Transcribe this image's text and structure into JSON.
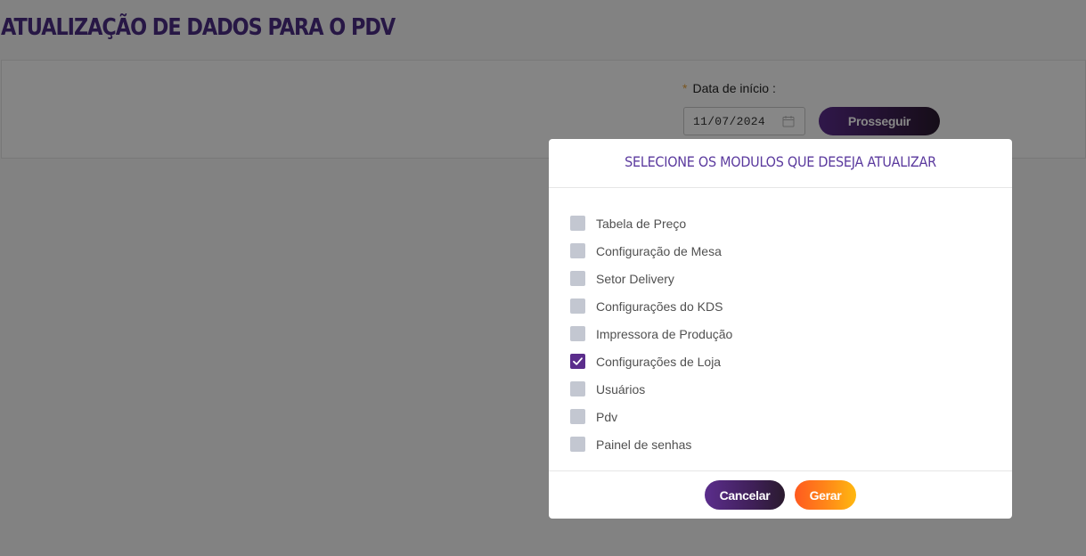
{
  "page": {
    "title": "ATUALIZAÇÃO DE DADOS PARA O PDV"
  },
  "form": {
    "required_mark": "*",
    "start_date_label": "Data de início",
    "label_suffix": ":",
    "start_date_value": "11/07/2024",
    "proceed_label": "Prosseguir"
  },
  "modal": {
    "title": "SELECIONE OS MODULOS QUE DESEJA ATUALIZAR",
    "options": [
      {
        "label": "Tabela de Preço",
        "checked": false
      },
      {
        "label": "Configuração de Mesa",
        "checked": false
      },
      {
        "label": "Setor Delivery",
        "checked": false
      },
      {
        "label": "Configurações do KDS",
        "checked": false
      },
      {
        "label": "Impressora de Produção",
        "checked": false
      },
      {
        "label": "Configurações de Loja",
        "checked": true
      },
      {
        "label": "Usuários",
        "checked": false
      },
      {
        "label": "Pdv",
        "checked": false
      },
      {
        "label": "Painel de senhas",
        "checked": false
      }
    ],
    "cancel_label": "Cancelar",
    "generate_label": "Gerar"
  },
  "colors": {
    "brand_purple": "#5b2d8c",
    "accent_orange": "#ff8a18"
  },
  "icons": {
    "date": "calendar-icon",
    "checked": "checkmark-icon"
  }
}
